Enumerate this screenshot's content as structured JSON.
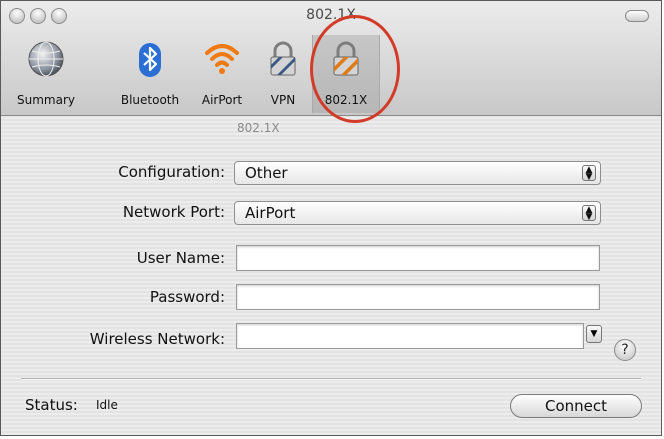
{
  "window": {
    "title": "802.1X"
  },
  "toolbar": {
    "items": [
      {
        "label": "Summary",
        "icon": "network-globe-icon"
      },
      {
        "label": "Bluetooth",
        "icon": "bluetooth-icon"
      },
      {
        "label": "AirPort",
        "icon": "airport-wifi-icon"
      },
      {
        "label": "VPN",
        "icon": "vpn-lock-icon"
      },
      {
        "label": "802.1X",
        "icon": "8021x-lock-icon"
      }
    ],
    "selected": "802.1X"
  },
  "form": {
    "section_label": "802.1X",
    "configuration": {
      "label": "Configuration:",
      "value": "Other"
    },
    "network_port": {
      "label": "Network Port:",
      "value": "AirPort"
    },
    "user_name": {
      "label": "User Name:",
      "value": ""
    },
    "password": {
      "label": "Password:",
      "value": ""
    },
    "wireless_network": {
      "label": "Wireless Network:",
      "value": ""
    }
  },
  "status": {
    "label": "Status:",
    "value": "Idle"
  },
  "buttons": {
    "connect": "Connect",
    "help": "?"
  },
  "colors": {
    "highlight_circle": "#d23b28",
    "airport_orange": "#f07a12",
    "bluetooth_blue": "#2b6fd6"
  }
}
